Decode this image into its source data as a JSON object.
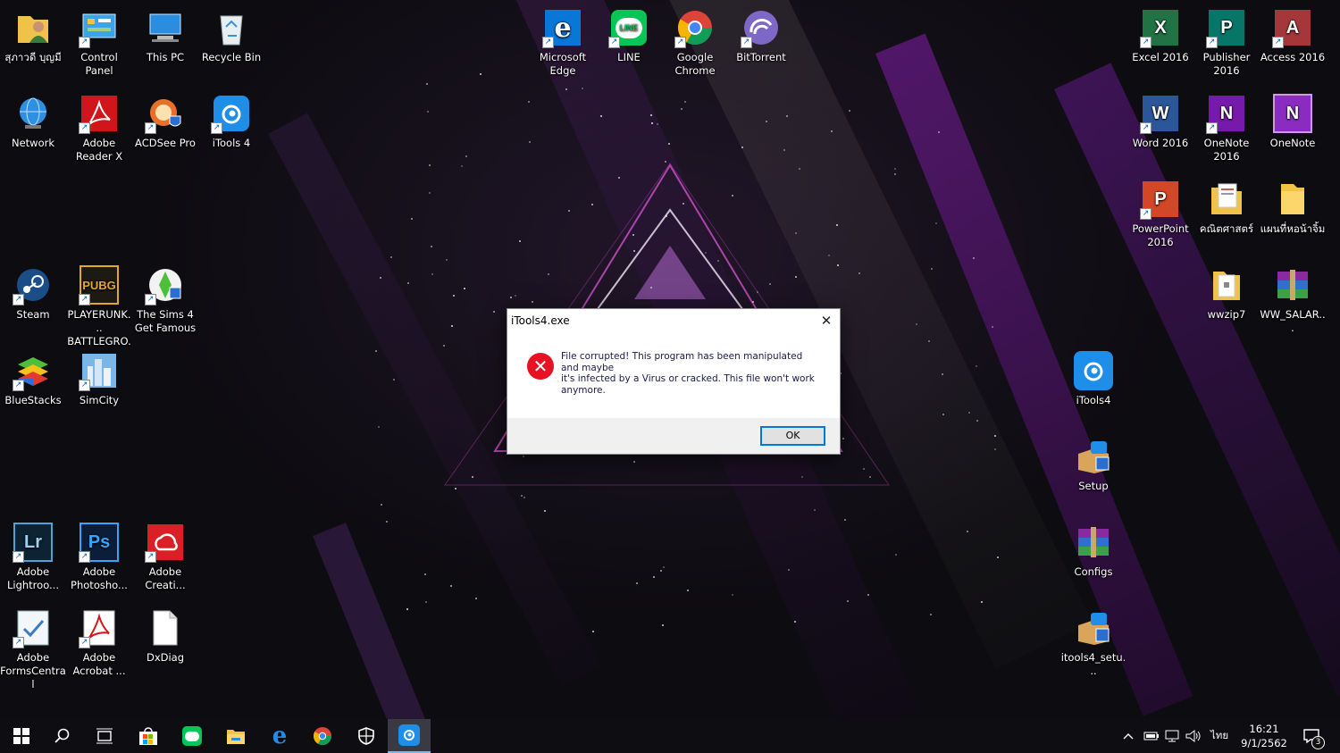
{
  "desktop": {
    "left_icons": [
      {
        "label": "สุภาวดี บุญมี",
        "icon": "user-folder-icon"
      },
      {
        "label": "Control Panel",
        "icon": "control-panel-icon"
      },
      {
        "label": "This PC",
        "icon": "this-pc-icon"
      },
      {
        "label": "Recycle Bin",
        "icon": "recycle-bin-icon"
      },
      {
        "label": "Network",
        "icon": "network-icon"
      },
      {
        "label": "Adobe Reader X",
        "icon": "adobe-reader-icon"
      },
      {
        "label": "ACDSee Pro",
        "icon": "acdsee-icon"
      },
      {
        "label": "iTools 4",
        "icon": "itools-icon"
      },
      {
        "label": "Steam",
        "icon": "steam-icon"
      },
      {
        "label": "PLAYERUNK... BATTLEGRO...",
        "icon": "pubg-icon"
      },
      {
        "label": "The Sims 4 Get Famous",
        "icon": "sims-icon"
      },
      {
        "label": "BlueStacks",
        "icon": "bluestacks-icon"
      },
      {
        "label": "SimCity",
        "icon": "simcity-icon"
      },
      {
        "label": "Adobe Lightroo...",
        "icon": "lightroom-icon"
      },
      {
        "label": "Adobe Photosho...",
        "icon": "photoshop-icon"
      },
      {
        "label": "Adobe Creati...",
        "icon": "creative-cloud-icon"
      },
      {
        "label": "Adobe FormsCentral",
        "icon": "forms-central-icon"
      },
      {
        "label": "Adobe Acrobat ...",
        "icon": "acrobat-icon"
      },
      {
        "label": "DxDiag",
        "icon": "file-icon"
      }
    ],
    "center_icons": [
      {
        "label": "Microsoft Edge",
        "icon": "edge-icon"
      },
      {
        "label": "LINE",
        "icon": "line-icon"
      },
      {
        "label": "Google Chrome",
        "icon": "chrome-icon"
      },
      {
        "label": "BitTorrent",
        "icon": "bittorrent-icon"
      }
    ],
    "right_icons": [
      {
        "label": "Excel 2016",
        "icon": "excel-icon"
      },
      {
        "label": "Publisher 2016",
        "icon": "publisher-icon"
      },
      {
        "label": "Access 2016",
        "icon": "access-icon"
      },
      {
        "label": "Word 2016",
        "icon": "word-icon"
      },
      {
        "label": "OneNote 2016",
        "icon": "onenote-2016-icon"
      },
      {
        "label": "OneNote",
        "icon": "onenote-icon"
      },
      {
        "label": "PowerPoint 2016",
        "icon": "powerpoint-icon"
      },
      {
        "label": "คณิตศาสตร์",
        "icon": "document-folder-icon"
      },
      {
        "label": "แผนที่หอน้าจิ้ม",
        "icon": "folder-icon"
      },
      {
        "label": "wwzip7",
        "icon": "document-folder-icon"
      },
      {
        "label": "WW_SALAR...",
        "icon": "winrar-icon"
      },
      {
        "label": "iTools4",
        "icon": "itools-icon"
      },
      {
        "label": "Setup",
        "icon": "setup-icon"
      },
      {
        "label": "Configs",
        "icon": "winrar-icon"
      },
      {
        "label": "itools4_setu...",
        "icon": "setup-icon"
      }
    ]
  },
  "dialog": {
    "title": "iTools4.exe",
    "message_lines": [
      "File corrupted! This program has been manipulated and maybe",
      "it's infected by a Virus or cracked. This file won't work anymore."
    ],
    "ok_label": "OK",
    "close_glyph": "✕",
    "error_glyph": "✕"
  },
  "taskbar": {
    "buttons": [
      {
        "name": "start-button",
        "icon": "windows-icon"
      },
      {
        "name": "search-button",
        "icon": "search-icon"
      },
      {
        "name": "task-view-button",
        "icon": "task-view-icon"
      },
      {
        "name": "store-button",
        "icon": "store-icon"
      },
      {
        "name": "line-taskbar-button",
        "icon": "line-icon"
      },
      {
        "name": "file-explorer-button",
        "icon": "folder-icon"
      },
      {
        "name": "edge-taskbar-button",
        "icon": "edge-icon"
      },
      {
        "name": "chrome-taskbar-button",
        "icon": "chrome-icon"
      },
      {
        "name": "security-button",
        "icon": "shield-icon"
      },
      {
        "name": "itools-taskbar-button",
        "icon": "itools-icon"
      }
    ],
    "language": "ไทย",
    "time": "16:21",
    "date": "9/1/2562",
    "notification_count": "3"
  },
  "colors": {
    "error_red": "#e81123",
    "focus_blue": "#0078d7",
    "word": "#2b579a",
    "excel": "#217346",
    "publisher": "#077568",
    "access": "#a4373a",
    "onenote": "#7719aa",
    "powerpoint": "#d24726"
  }
}
